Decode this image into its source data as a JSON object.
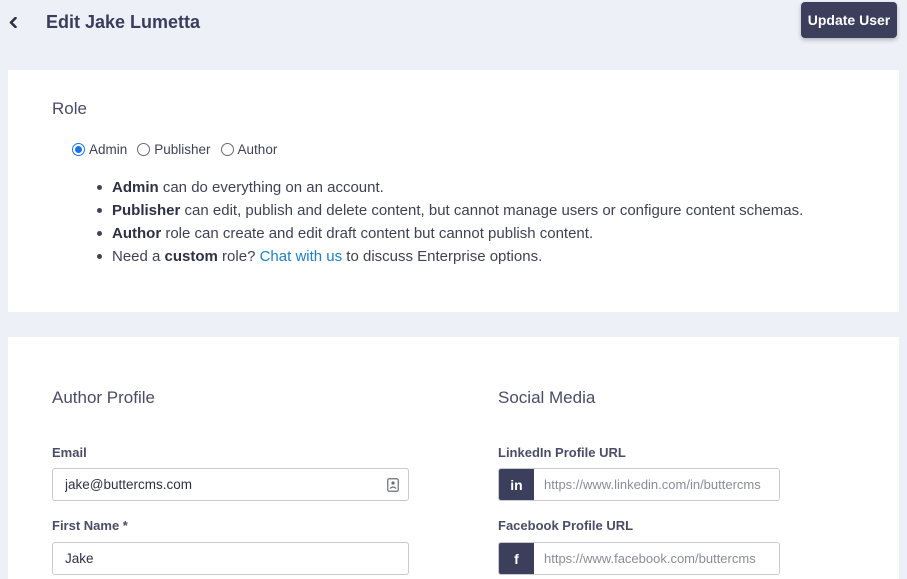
{
  "header": {
    "title": "Edit Jake Lumetta",
    "update_button": "Update User",
    "back_icon": "chevron-left-icon"
  },
  "role": {
    "heading": "Role",
    "options": [
      {
        "label": "Admin",
        "checked": true
      },
      {
        "label": "Publisher",
        "checked": false
      },
      {
        "label": "Author",
        "checked": false
      }
    ],
    "descriptions": [
      {
        "bold": "Admin",
        "text": " can do everything on an account."
      },
      {
        "bold": "Publisher",
        "text": " can edit, publish and delete content, but cannot manage users or configure content schemas."
      },
      {
        "bold": "Author",
        "text": " role can create and edit draft content but cannot publish content."
      }
    ],
    "custom": {
      "prefix": "Need a ",
      "bold": "custom",
      "middle": " role? ",
      "link": "Chat with us",
      "suffix": " to discuss Enterprise options."
    }
  },
  "author_profile": {
    "heading": "Author Profile",
    "email_label": "Email",
    "email_value": "jake@buttercms.com",
    "first_name_label": "First Name *",
    "first_name_value": "Jake"
  },
  "social_media": {
    "heading": "Social Media",
    "linkedin_label": "LinkedIn Profile URL",
    "linkedin_badge": "in",
    "linkedin_placeholder": "https://www.linkedin.com/in/buttercms",
    "facebook_label": "Facebook Profile URL",
    "facebook_badge": "f",
    "facebook_placeholder": "https://www.facebook.com/buttercms"
  },
  "colors": {
    "page_bg": "#eef0f8",
    "primary_button": "#3b3f5c",
    "link": "#1d7fc0",
    "radio_checked": "#1a73e8"
  }
}
